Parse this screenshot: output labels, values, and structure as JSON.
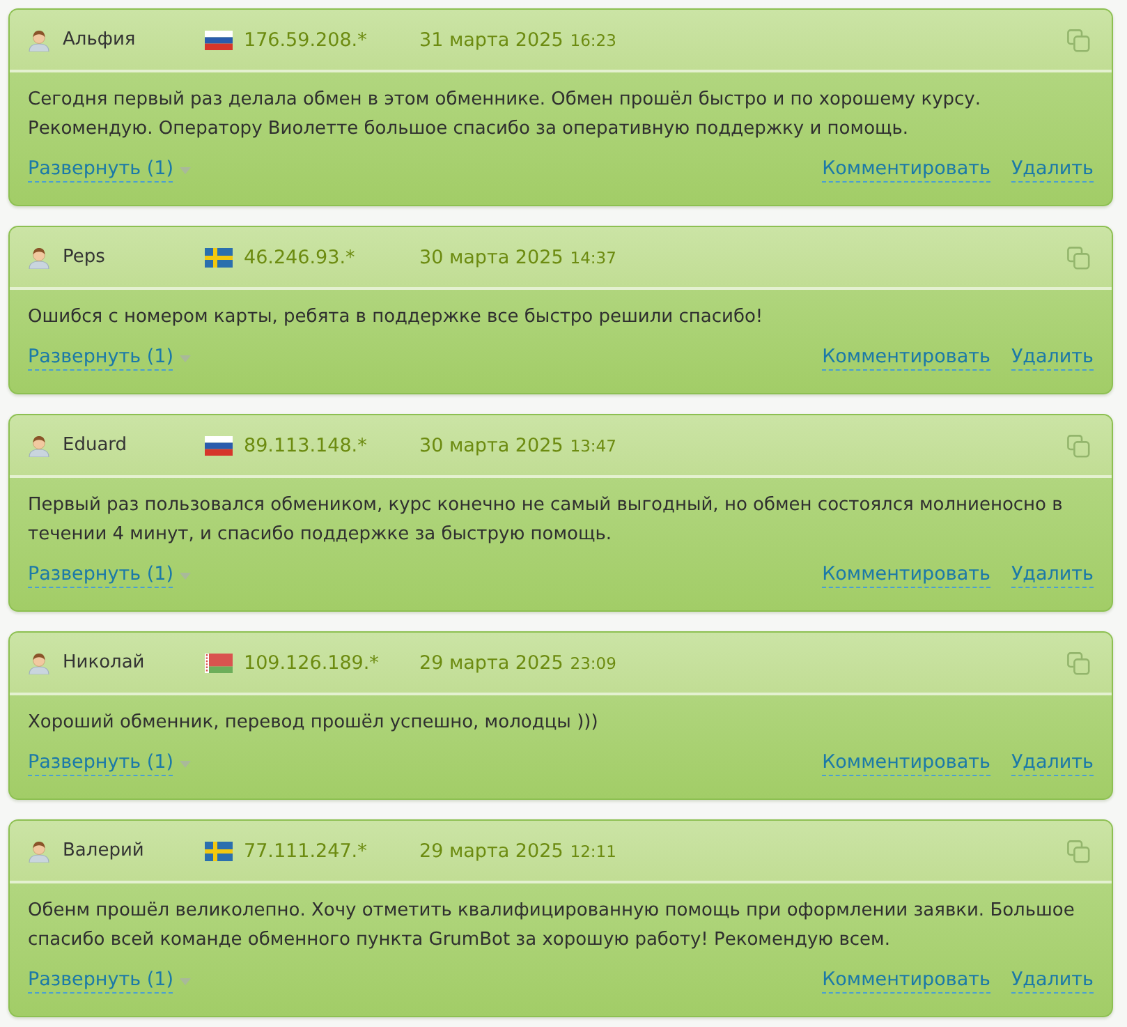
{
  "reviews": [
    {
      "author": "Альфия",
      "flag": {
        "kind": "russia"
      },
      "ip": "176.59.208.*",
      "date": "31 марта 2025",
      "time": "16:23",
      "text": "Сегодня первый раз делала обмен в этом обменнике. Обмен прошёл быстро и по хорошему курсу. Рекомендую. Оператору Виолетте большое спасибо за оперативную поддержку и помощь.",
      "expand": "Развернуть (1)",
      "comment": "Комментировать",
      "delete": "Удалить"
    },
    {
      "author": "Peps",
      "flag": {
        "kind": "sweden"
      },
      "ip": "46.246.93.*",
      "date": "30 марта 2025",
      "time": "14:37",
      "text": "Ошибся с номером карты, ребята в поддержке все быстро решили спасибо!",
      "expand": "Развернуть (1)",
      "comment": "Комментировать",
      "delete": "Удалить"
    },
    {
      "author": "Eduard",
      "flag": {
        "kind": "russia"
      },
      "ip": "89.113.148.*",
      "date": "30 марта 2025",
      "time": "13:47",
      "text": "Первый раз пользовался обмеником, курс конечно не самый выгодный, но обмен состоялся молниеносно в течении 4 минут, и спасибо поддержке за быструю помощь.",
      "expand": "Развернуть (1)",
      "comment": "Комментировать",
      "delete": "Удалить"
    },
    {
      "author": "Николай",
      "flag": {
        "kind": "belarus"
      },
      "ip": "109.126.189.*",
      "date": "29 марта 2025",
      "time": "23:09",
      "text": "Хороший обменник, перевод прошёл успешно, молодцы )))",
      "expand": "Развернуть (1)",
      "comment": "Комментировать",
      "delete": "Удалить"
    },
    {
      "author": "Валерий",
      "flag": {
        "kind": "sweden"
      },
      "ip": "77.111.247.*",
      "date": "29 марта 2025",
      "time": "12:11",
      "text": "Обенм прошёл великолепно. Хочу отметить квалифицированную помощь при оформлении заявки. Большое спасибо всей команде обменного пункта GrumBot за хорошую работу! Рекомендую всем.",
      "expand": "Развернуть (1)",
      "comment": "Комментировать",
      "delete": "Удалить"
    }
  ]
}
